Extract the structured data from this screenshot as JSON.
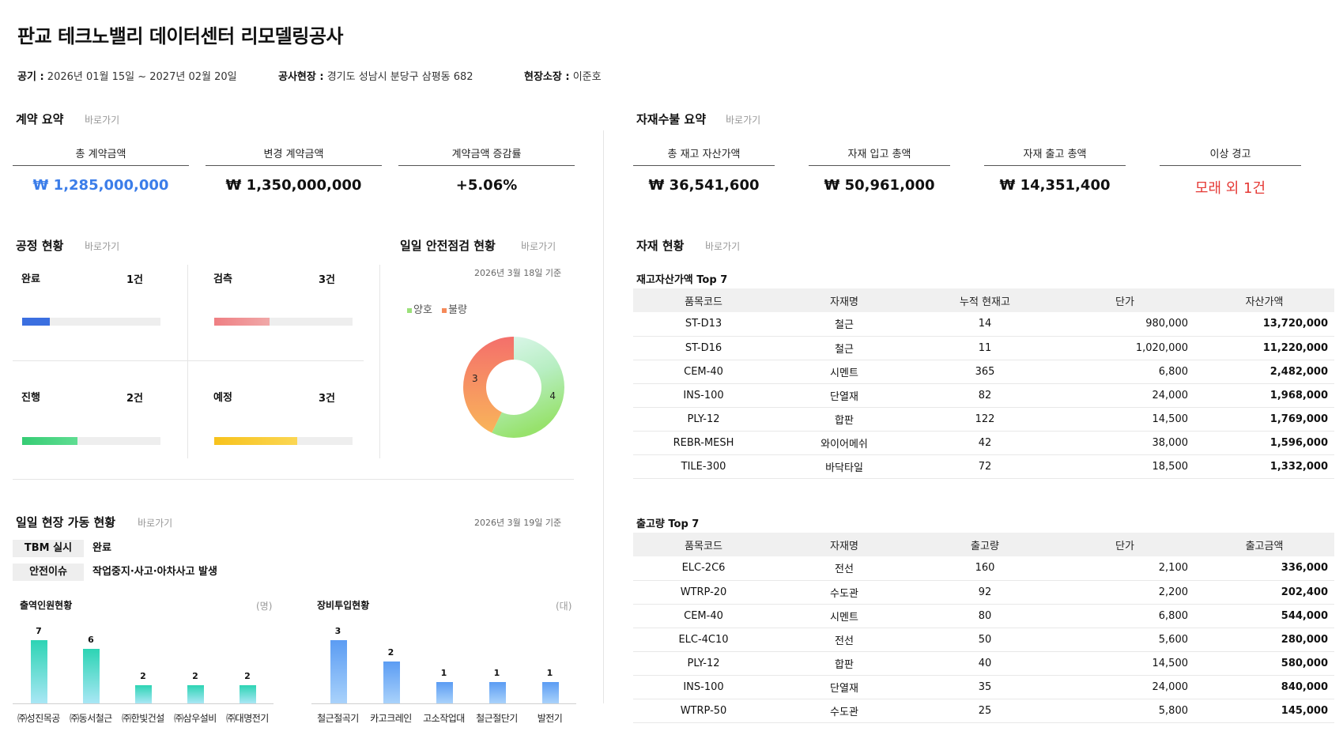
{
  "page_title": "판교 테크노밸리 데이터센터 리모델링공사",
  "info": {
    "period_label": "공기 :",
    "period_value": "2026년 01월 15일 ~ 2027년 02월 20일",
    "site_label": "공사현장 :",
    "site_value": "경기도 성남시 분당구 삼평동 682",
    "manager_label": "현장소장 :",
    "manager_value": "이준호"
  },
  "shortcut_label": "바로가기",
  "shortcut_sep": "I",
  "contract": {
    "title": "계약 요약",
    "items": [
      {
        "label": "총 계약금액",
        "value": "₩ 1,285,000,000",
        "color": "#3b7de9"
      },
      {
        "label": "변경 계약금액",
        "value": "₩ 1,350,000,000",
        "color": "#111111"
      },
      {
        "label": "계약금액 증감률",
        "value": "+5.06%",
        "color": "#111111"
      }
    ]
  },
  "material_summary": {
    "title": "자재수불 요약",
    "items": [
      {
        "label": "총 재고 자산가액",
        "value": "₩ 36,541,600",
        "color": "#111111"
      },
      {
        "label": "자재 입고 총액",
        "value": "₩ 50,961,000",
        "color": "#111111"
      },
      {
        "label": "자재 출고 총액",
        "value": "₩ 14,351,400",
        "color": "#111111"
      },
      {
        "label": "이상 경고",
        "value": "모래 외 1건",
        "color": "#e53935"
      }
    ]
  },
  "process": {
    "title": "공정 현황",
    "items": [
      {
        "label": "완료",
        "count": "1건",
        "ratio": 0.2,
        "color": "#3b6fe0"
      },
      {
        "label": "검측",
        "count": "3건",
        "ratio": 0.4,
        "color": "#ec8a8a"
      },
      {
        "label": "진행",
        "count": "2건",
        "ratio": 0.4,
        "color": "#3ecf7a"
      },
      {
        "label": "예정",
        "count": "3건",
        "ratio": 0.6,
        "color": "#f7c62f"
      }
    ]
  },
  "safety": {
    "title": "일일 안전점검 현황",
    "date": "2026년 3월 18일 기준",
    "legend": [
      {
        "label": "양호",
        "color": "#9be07a"
      },
      {
        "label": "불량",
        "color": "#f58a5a"
      }
    ],
    "values": [
      4,
      3
    ]
  },
  "inventory": {
    "title": "자재 현황",
    "top_asset_title": "재고자산가액 Top 7",
    "asset_headers": [
      "품목코드",
      "자재명",
      "누적 현재고",
      "단가",
      "자산가액"
    ],
    "asset_rows": [
      [
        "ST-D13",
        "철근",
        "14",
        "980,000",
        "13,720,000"
      ],
      [
        "ST-D16",
        "철근",
        "11",
        "1,020,000",
        "11,220,000"
      ],
      [
        "CEM-40",
        "시멘트",
        "365",
        "6,800",
        "2,482,000"
      ],
      [
        "INS-100",
        "단열재",
        "82",
        "24,000",
        "1,968,000"
      ],
      [
        "PLY-12",
        "합판",
        "122",
        "14,500",
        "1,769,000"
      ],
      [
        "REBR-MESH",
        "와이어메쉬",
        "42",
        "38,000",
        "1,596,000"
      ],
      [
        "TILE-300",
        "바닥타일",
        "72",
        "18,500",
        "1,332,000"
      ]
    ],
    "top_out_title": "출고량 Top 7",
    "out_headers": [
      "품목코드",
      "자재명",
      "출고량",
      "단가",
      "출고금액"
    ],
    "out_rows": [
      [
        "ELC-2C6",
        "전선",
        "160",
        "2,100",
        "336,000"
      ],
      [
        "WTRP-20",
        "수도관",
        "92",
        "2,200",
        "202,400"
      ],
      [
        "CEM-40",
        "시멘트",
        "80",
        "6,800",
        "544,000"
      ],
      [
        "ELC-4C10",
        "전선",
        "50",
        "5,600",
        "280,000"
      ],
      [
        "PLY-12",
        "합판",
        "40",
        "14,500",
        "580,000"
      ],
      [
        "INS-100",
        "단열재",
        "35",
        "24,000",
        "840,000"
      ],
      [
        "WTRP-50",
        "수도관",
        "25",
        "5,800",
        "145,000"
      ]
    ]
  },
  "daily": {
    "title": "일일 현장 가동 현황",
    "date": "2026년 3월 19일 기준",
    "tbm_label": "TBM 실시",
    "tbm_value": "완료",
    "issue_label": "안전이슈",
    "issue_value": "작업중지·사고·아차사고 발생",
    "workers_title": "출역인원현황",
    "workers_unit": "(명)",
    "equip_title": "장비투입현황",
    "equip_unit": "(대)"
  },
  "chart_data": [
    {
      "type": "bar",
      "title": "출역인원현황",
      "ylabel": "(명)",
      "categories": [
        "㈜성진목공",
        "㈜동서철근",
        "㈜한빛건설",
        "㈜삼우설비",
        "㈜대명전기"
      ],
      "values": [
        7,
        6,
        2,
        2,
        2
      ],
      "ylim": [
        0,
        7
      ]
    },
    {
      "type": "bar",
      "title": "장비투입현황",
      "ylabel": "(대)",
      "categories": [
        "철근절곡기",
        "카고크레인",
        "고소작업대",
        "철근절단기",
        "발전기"
      ],
      "values": [
        3,
        2,
        1,
        1,
        1
      ],
      "ylim": [
        0,
        3
      ]
    },
    {
      "type": "pie",
      "title": "일일 안전점검 현황",
      "categories": [
        "양호",
        "불량"
      ],
      "values": [
        4,
        3
      ]
    }
  ]
}
